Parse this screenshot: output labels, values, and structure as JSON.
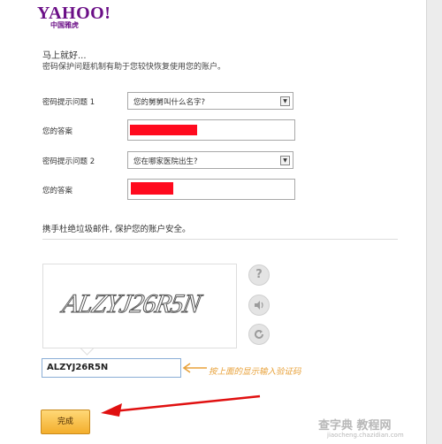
{
  "brand": {
    "logo": "YAHOO!",
    "sub": "中国雅虎"
  },
  "intro": {
    "greeting": "马上就好...",
    "description": "密码保护问题机制有助于您较快恢复使用您的账户。"
  },
  "security": {
    "q1_label": "密码提示问题 1",
    "q1_value": "您的舅舅叫什么名字?",
    "a1_label": "您的答案",
    "q2_label": "密码提示问题 2",
    "q2_value": "您在哪家医院出生?",
    "a2_label": "您的答案"
  },
  "spam_section": {
    "title": "携手杜绝垃圾邮件, 保护您的账户安全。"
  },
  "captcha": {
    "image_text": "ALZYJ26R5N",
    "input_value": "ALZYJ26R5N"
  },
  "annotation": {
    "hint": "按上面的显示输入验证码",
    "color": "#e8a23b",
    "arrow_color": "#e01010"
  },
  "submit_label": "完成",
  "watermark": {
    "line1": "查字典 教程网",
    "line2": "jiaocheng.chazidian.com"
  },
  "colors": {
    "brand": "#6b0f87",
    "redaction": "#ff0a1e",
    "button": "#f3ae2c"
  }
}
